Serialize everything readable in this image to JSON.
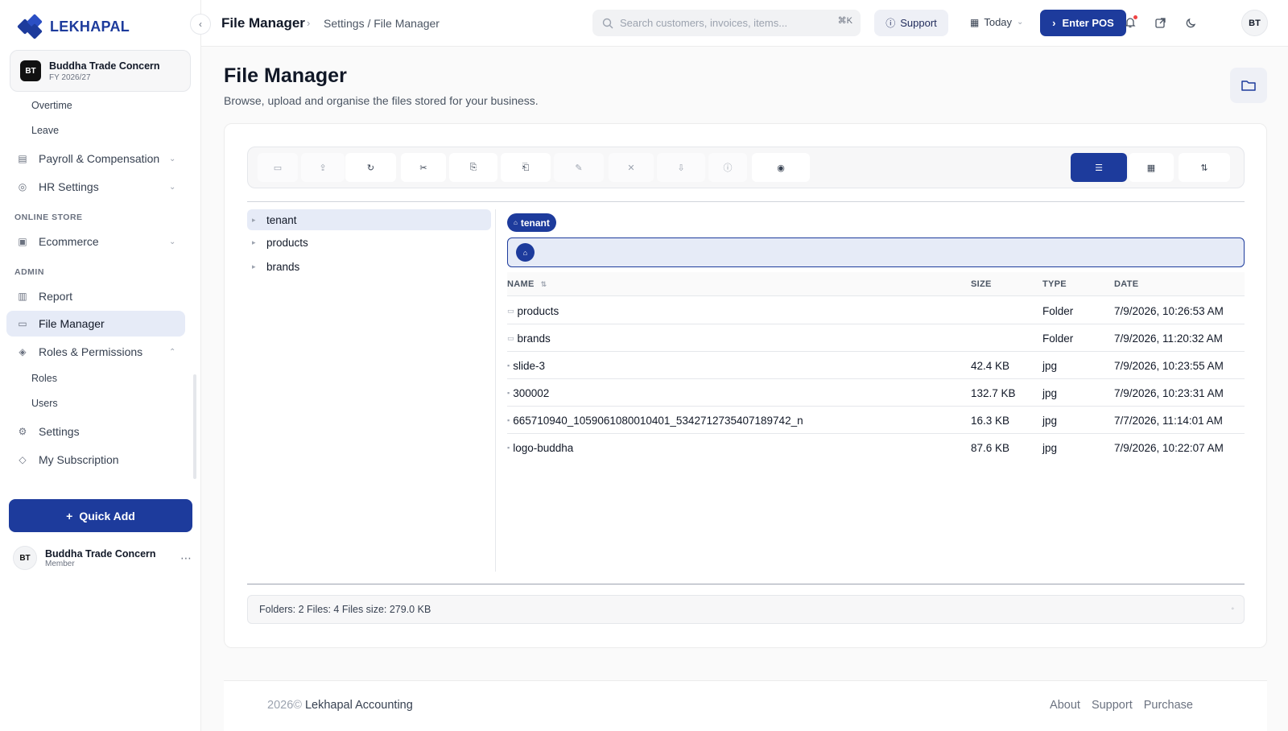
{
  "brand": {
    "name": "LEKHAPAL"
  },
  "org": {
    "initials": "BT",
    "name": "Buddha Trade Concern",
    "fiscal_year": "FY 2026/27"
  },
  "sidebar": {
    "subitems_top": [
      "Overtime",
      "Leave"
    ],
    "items": [
      {
        "label": "Payroll & Compensation",
        "icon": "payroll-icon"
      },
      {
        "label": "HR Settings",
        "icon": "hr-settings-icon"
      },
      {
        "label": "Ecommerce",
        "icon": "ecommerce-icon"
      },
      {
        "label": "Report",
        "icon": "report-icon"
      },
      {
        "label": "File Manager",
        "icon": "folder-icon"
      },
      {
        "label": "Roles & Permissions",
        "icon": "shield-icon"
      },
      {
        "label": "Settings",
        "icon": "gear-icon"
      },
      {
        "label": "My Subscription",
        "icon": "subscription-icon"
      }
    ],
    "sections": {
      "online_store": "ONLINE STORE",
      "admin": "ADMIN"
    },
    "roles_sub": [
      "Roles",
      "Users"
    ],
    "quick_add": "Quick Add",
    "user": {
      "initials": "BT",
      "name": "Buddha Trade Concern",
      "role": "Member"
    }
  },
  "header": {
    "title": "File Manager",
    "breadcrumb": "Settings / File Manager",
    "search_placeholder": "Search customers, invoices, items...",
    "search_shortcut": "⌘K",
    "support": "Support",
    "date_filter": "Today",
    "pos": "Enter POS",
    "avatar": "BT"
  },
  "page": {
    "title": "File Manager",
    "subtitle": "Browse, upload and organise the files stored for your business."
  },
  "tree": [
    {
      "label": "tenant",
      "active": true
    },
    {
      "label": "products"
    },
    {
      "label": "brands"
    }
  ],
  "current_folder": "tenant",
  "table": {
    "headers": {
      "name": "NAME",
      "size": "SIZE",
      "type": "TYPE",
      "date": "DATE"
    },
    "rows": [
      {
        "name": "products",
        "size": "",
        "type": "Folder",
        "date": "7/9/2026, 10:26:53 AM",
        "kind": "folder"
      },
      {
        "name": "brands",
        "size": "",
        "type": "Folder",
        "date": "7/9/2026, 11:20:32 AM",
        "kind": "folder"
      },
      {
        "name": "slide-3",
        "size": "42.4 KB",
        "type": "jpg",
        "date": "7/9/2026, 10:23:55 AM",
        "kind": "file"
      },
      {
        "name": "300002",
        "size": "132.7 KB",
        "type": "jpg",
        "date": "7/9/2026, 10:23:31 AM",
        "kind": "file"
      },
      {
        "name": "665710940_1059061080010401_5342712735407189742_n",
        "size": "16.3 KB",
        "type": "jpg",
        "date": "7/7/2026, 11:14:01 AM",
        "kind": "file"
      },
      {
        "name": "logo-buddha",
        "size": "87.6 KB",
        "type": "jpg",
        "date": "7/9/2026, 10:22:07 AM",
        "kind": "file"
      }
    ]
  },
  "status": "Folders: 2 Files: 4 Files size: 279.0 KB",
  "footer": {
    "year": "2026©",
    "company": "Lekhapal Accounting",
    "links": [
      "About",
      "Support",
      "Purchase"
    ]
  },
  "colors": {
    "accent": "#1d3b9c",
    "active_bg": "#e6ebf7"
  }
}
